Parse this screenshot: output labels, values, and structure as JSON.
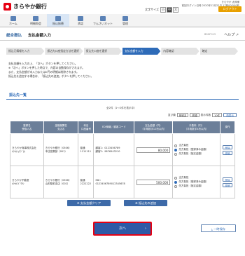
{
  "header": {
    "logo_text": "きらやか銀行",
    "links": "前回ログイン日時 2020年12月22日 17時00分00秒",
    "user": "きらやか 太郎様",
    "font_size_label": "文字サイズ",
    "font_small": "小",
    "font_medium": "中",
    "font_large": "大",
    "logout": "ログアウト"
  },
  "nav": [
    {
      "label": "ホーム"
    },
    {
      "label": "明細照会"
    },
    {
      "label": "振込振替"
    },
    {
      "label": "承認"
    },
    {
      "label": "でんさいネット"
    },
    {
      "label": "管理"
    }
  ],
  "title": {
    "breadcrumb": "総合振込",
    "page": "支払金額入力",
    "code": "BSGF013",
    "help": "ヘルプ"
  },
  "steps": [
    "振込元情報を入力",
    "振込先口座指定方法を選択",
    "振込先口座を選択",
    "支払金額を入力",
    "内容確認",
    "確定"
  ],
  "notes": [
    "支払金額を入力の上、「次へ」ボタンを押してください。",
    "※「次へ」ボタンを押した時点で、内容の自動保存がされます。",
    "また、支払金額が未入力または0円の明細は削除されます。",
    "振込先を追加する場合は、「振込先の追加」ボタンを押してください。"
  ],
  "section_title": "振込先一覧",
  "table_info": "全2件（1〜2件を表示中）",
  "controls": {
    "sort_label": "並び順",
    "sort_value": "登録名",
    "order_value": "昇順",
    "per_page_label": "表示件数",
    "per_page_value": "10件",
    "redisplay": "再表示"
  },
  "headers": [
    "登録名\n受取人名",
    "金融機関名\n支店名",
    "科目\n口座番号",
    "EDI情報／顧客コード",
    "支払金額（円）\n（半角数字12桁以内）",
    "手数料（円）\n（半角数字4桁以内）",
    "操作"
  ],
  "rows": [
    {
      "name": "きらやか商事株式会社",
      "kana": "ｷﾗﾔｶｼｮｳｼﾞ(ｶ",
      "bank": "きらやか銀行（0506）",
      "branch": "本店営業部（001）",
      "type": "普通",
      "account": "1111111",
      "edi": "顧客1：0123456789",
      "edi2": "顧客2：9876543210",
      "amount": "80,000",
      "fee_opts": [
        "当方負担",
        "先方負担（登録済み金額）",
        "先方負担（指定金額）"
      ],
      "fee_sel": 1,
      "op1": "削除",
      "op2": "詳細"
    },
    {
      "name": "きらやか不動産",
      "kana": "ｷﾗﾔｶﾌﾄﾞｳｻﾝ",
      "bank": "きらやか銀行（0506）",
      "branch": "山形駅前支店（002）",
      "type": "普通",
      "account": "2222222",
      "edi": "EDI：",
      "edi2": "0123456789012345678",
      "amount": "500,000",
      "fee_opts": [
        "当方負担",
        "先方負担（登録済み金額）",
        "先方負担（指定金額）"
      ],
      "fee_sel": 1,
      "op1": "削除",
      "op2": "詳細"
    }
  ],
  "actions": {
    "clear": "支払金額クリア",
    "add": "振込先の追加",
    "next": "次へ",
    "save": "一時保存"
  }
}
